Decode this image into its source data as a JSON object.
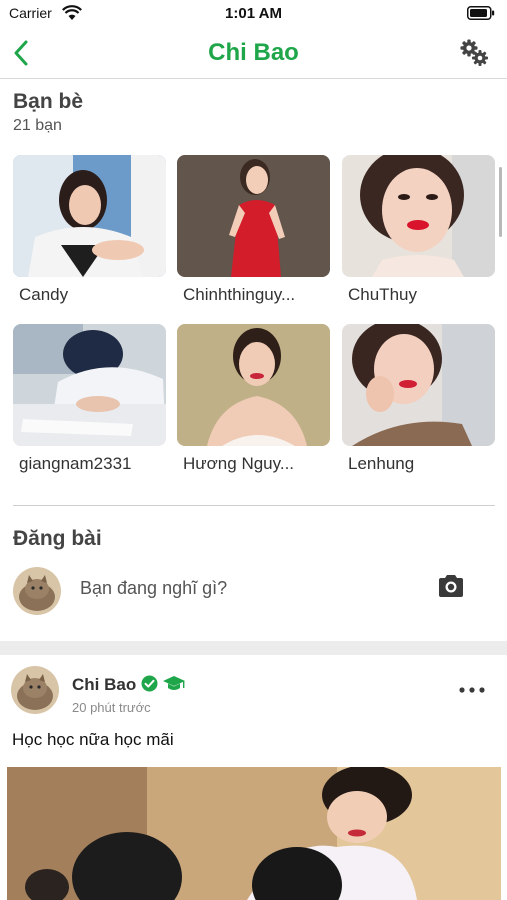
{
  "status_bar": {
    "carrier": "Carrier",
    "time": "1:01 AM",
    "icons": [
      "wifi-icon",
      "battery-icon"
    ]
  },
  "nav": {
    "title": "Chi Bao",
    "back_icon": "chevron-left-icon",
    "settings_icon": "gears-icon"
  },
  "friends": {
    "title": "Bạn bè",
    "count": "21 bạn",
    "items": [
      {
        "name": "Candy"
      },
      {
        "name": "Chinhthinguy..."
      },
      {
        "name": "ChuThuy"
      },
      {
        "name": "giangnam2331"
      },
      {
        "name": "Hương Nguy..."
      },
      {
        "name": "Lenhung"
      }
    ]
  },
  "create_post": {
    "title": "Đăng bài",
    "placeholder": "Bạn đang nghĩ gì?",
    "camera_icon": "camera-icon"
  },
  "post": {
    "author": "Chi Bao",
    "time": "20 phút trước",
    "text": "Học học nữa học mãi",
    "badges": [
      "verified-check-icon",
      "graduation-cap-icon"
    ],
    "more_icon": "more-horizontal-icon"
  },
  "colors": {
    "brand_green": "#1fa64a",
    "section_gap": "#ececec",
    "divider": "#cfcfcf"
  }
}
